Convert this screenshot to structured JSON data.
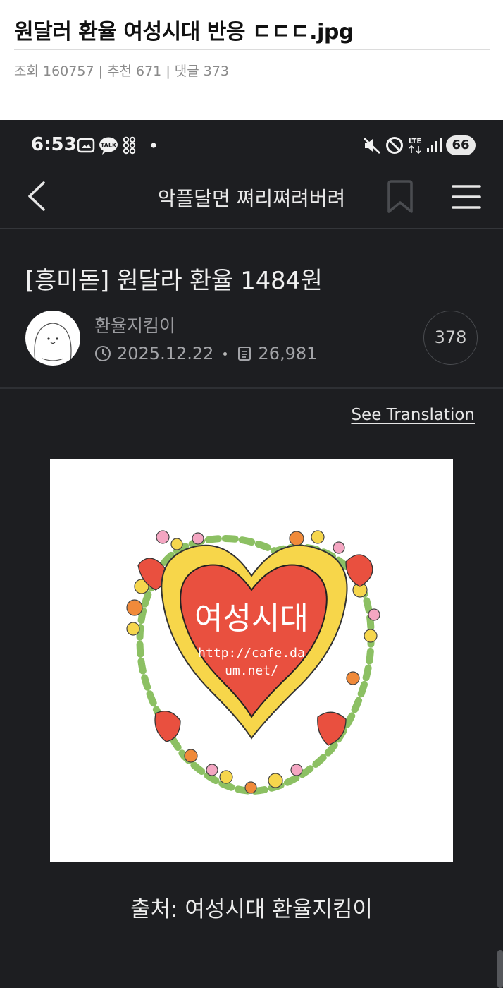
{
  "post": {
    "title": "원달러 환율 여성시대 반응 ㄷㄷㄷ.jpg",
    "meta": "조회 160757 | 추천 671 | 댓글 373"
  },
  "status_bar": {
    "time": "6:53",
    "talk_badge": "TALK",
    "network": "LTE",
    "battery": "66"
  },
  "appbar": {
    "title": "악플달면 쪄리쪄려버려"
  },
  "article": {
    "title": "[흥미돋] 원달라 환율 1484원",
    "author": "환율지킴이",
    "date": "2025.12.22",
    "views": "26,981",
    "comments": "378",
    "see_translation": "See Translation",
    "image_text": "여성시대",
    "image_url_line1": "http://cafe.da",
    "image_url_line2": "um.net/",
    "caption": "출처: 여성시대 환율지킴이"
  },
  "colors": {
    "background": "#1d1e21",
    "heart_red": "#e9503f",
    "heart_border": "#f7d64a"
  },
  "icons": [
    "chevron-left-icon",
    "bookmark-icon",
    "menu-icon",
    "clock-icon",
    "document-icon",
    "mute-icon",
    "do-not-disturb-icon",
    "signal-icon",
    "screenshot-icon",
    "talk-bubble-icon"
  ]
}
